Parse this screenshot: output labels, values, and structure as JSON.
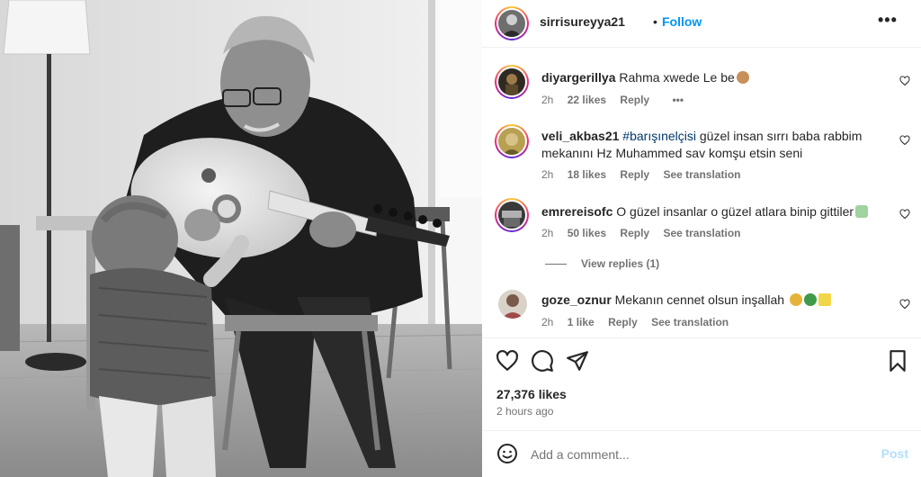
{
  "post": {
    "author": "sirrisureyya21",
    "separator": "•",
    "follow_label": "Follow",
    "more_label": "•••"
  },
  "comments": [
    {
      "user": "diyargerillya",
      "text": "Rahma xwede Le be",
      "time": "2h",
      "likes": "22 likes",
      "reply": "Reply",
      "extra": "•••",
      "emoji_color": "#c98f5a"
    },
    {
      "user": "veli_akbas21",
      "hashtag": "#barışınelçisi",
      "text": "güzel insan sırrı baba rabbim mekanını Hz Muhammed sav komşu etsin seni",
      "time": "2h",
      "likes": "18 likes",
      "reply": "Reply",
      "translate": "See translation"
    },
    {
      "user": "emrereisofc",
      "text": "O güzel insanlar o güzel atlara binip gittiler",
      "time": "2h",
      "likes": "50 likes",
      "reply": "Reply",
      "translate": "See translation",
      "emoji_color": "#9fd3a0",
      "view_replies": "View replies (1)"
    },
    {
      "user": "goze_oznur",
      "text": "Mekanın cennet olsun inşallah",
      "time": "2h",
      "likes": "1 like",
      "reply": "Reply",
      "translate": "See translation"
    }
  ],
  "stats": {
    "likes": "27,376 likes",
    "posted": "2 hours ago"
  },
  "composer": {
    "placeholder": "Add a comment...",
    "post_label": "Post"
  },
  "icons": {
    "like": "heart-icon",
    "comment": "comment-icon",
    "share": "share-icon",
    "save": "bookmark-icon",
    "emoji": "emoji-icon"
  }
}
